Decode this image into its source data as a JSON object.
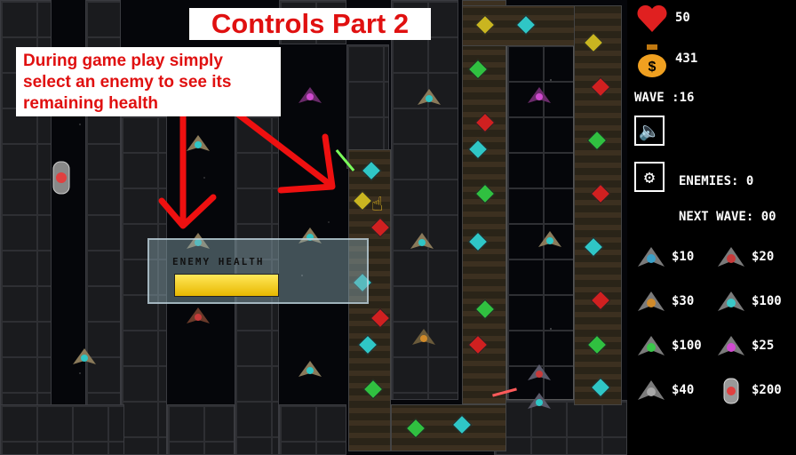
{
  "title": "Controls Part 2",
  "instruction": "During game play simply select an enemy to see its remaining health",
  "health_panel": {
    "label": "ENEMY HEALTH",
    "health_fraction": 1.0
  },
  "sidebar": {
    "lives": "50",
    "money": "431",
    "wave": "WAVE :16",
    "enemies": "ENEMIES: 0",
    "next_wave": "NEXT WAVE: 00"
  },
  "shop": [
    {
      "price": "$10",
      "icon": "scout-ship-icon",
      "color": "#3aa0c8"
    },
    {
      "price": "$20",
      "icon": "striker-ship-icon",
      "color": "#c83a3a"
    },
    {
      "price": "$30",
      "icon": "gunner-ship-icon",
      "color": "#d08a2a"
    },
    {
      "price": "$100",
      "icon": "frigate-ship-icon",
      "color": "#3ac8c8"
    },
    {
      "price": "$100",
      "icon": "green-ship-icon",
      "color": "#3ac84a"
    },
    {
      "price": "$25",
      "icon": "pink-ship-icon",
      "color": "#d04ad0"
    },
    {
      "price": "$40",
      "icon": "heavy-ship-icon",
      "color": "#a8a8a8"
    },
    {
      "price": "$200",
      "icon": "turret-pod-icon",
      "color": "#e04040"
    }
  ],
  "colors": {
    "title_text": "#e01010",
    "arrow": "#ee1010",
    "health": "#f0c820",
    "heart": "#e02020",
    "money_bag": "#f0a020"
  }
}
